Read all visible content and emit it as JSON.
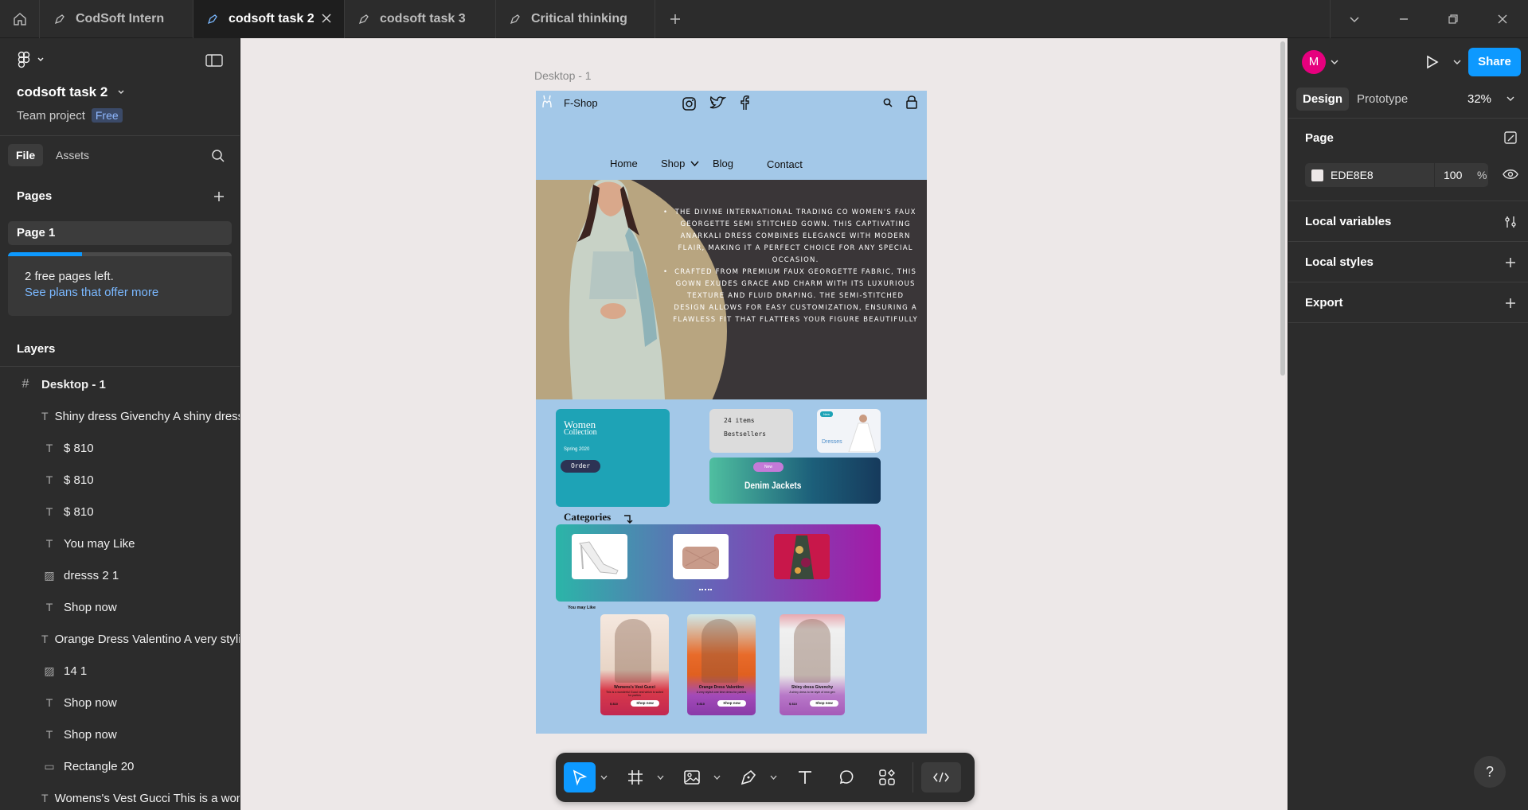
{
  "tabs": [
    {
      "label": "CodSoft Intern"
    },
    {
      "label": "codsoft task 2"
    },
    {
      "label": "codsoft task 3"
    },
    {
      "label": "Critical thinking"
    }
  ],
  "file": {
    "name": "codsoft task 2",
    "team": "Team project",
    "plan_badge": "Free"
  },
  "left_tabs": {
    "file": "File",
    "assets": "Assets"
  },
  "pages": {
    "title": "Pages",
    "items": [
      "Page 1"
    ],
    "notice": "2 free pages left.",
    "notice_link": "See plans that offer more",
    "notice_progress": 0.33
  },
  "layers": {
    "title": "Layers",
    "root": "Desktop - 1",
    "items": [
      {
        "label": "Shiny dress Givenchy A shiny dress",
        "icon": "text-icon"
      },
      {
        "label": "$ 810",
        "icon": "text-icon"
      },
      {
        "label": "$ 810",
        "icon": "text-icon"
      },
      {
        "label": "$ 810",
        "icon": "text-icon"
      },
      {
        "label": "You may Like",
        "icon": "text-icon"
      },
      {
        "label": "dresss 2 1",
        "icon": "image-icon"
      },
      {
        "label": "Shop now",
        "icon": "text-icon"
      },
      {
        "label": "Orange Dress Valentino A very stylish",
        "icon": "text-icon"
      },
      {
        "label": "14 1",
        "icon": "image-icon"
      },
      {
        "label": "Shop now",
        "icon": "text-icon"
      },
      {
        "label": "Shop now",
        "icon": "text-icon"
      },
      {
        "label": "Rectangle 20",
        "icon": "rectangle-icon"
      },
      {
        "label": "Womens's Vest Gucci This is a wonderful",
        "icon": "text-icon"
      }
    ]
  },
  "canvas": {
    "frame_label": "Desktop - 1"
  },
  "design": {
    "brand": "F-Shop",
    "nav": [
      "Home",
      "Shop",
      "Blog",
      "Contact"
    ],
    "hero_bullets": [
      "The Divine International Trading Co Women's Faux Georgette Semi Stitched Gown. This captivating Anarkali dress combines elegance with modern flair, making it a perfect choice for any special occasion.",
      "Crafted from premium faux georgette fabric, this gown exudes grace and charm with its luxurious texture and fluid draping. The semi-stitched design allows for easy customization, ensuring a flawless fit that flatters your figure beautifully"
    ],
    "women_collection": {
      "title": "Women",
      "subtitle": "Collection",
      "season": "Spring 2020",
      "button": "Order"
    },
    "bestsellers": {
      "count": "24 items",
      "label": "Bestsellers"
    },
    "dresses": {
      "badge": "New",
      "label": "Dresses"
    },
    "denim": {
      "badge": "New",
      "label": "Denim Jackets"
    },
    "categories": "Categories",
    "you_may_like": "You may Like",
    "products": [
      {
        "name": "Womens's Vest Gucci",
        "desc": "This is a wonderful Gucci vest which is suited for parties",
        "price": "$ 810",
        "button": "Shop now"
      },
      {
        "name": "Orange Dress Valentino",
        "desc": "A very stylish one time dress for parties",
        "price": "$ 810",
        "button": "Shop now"
      },
      {
        "name": "Shiny dress Givenchy",
        "desc": "A shiny dress to be style of new gen",
        "price": "$ 810",
        "button": "Shop now"
      }
    ]
  },
  "right_panel": {
    "avatar": "M",
    "share": "Share",
    "tabs": {
      "design": "Design",
      "prototype": "Prototype"
    },
    "zoom": "32%",
    "page_title": "Page",
    "page_color": "EDE8E8",
    "page_opacity": "100",
    "page_opacity_unit": "%",
    "sections": [
      "Local variables",
      "Local styles",
      "Export"
    ]
  },
  "colors": {
    "accent": "#0d99ff",
    "frame_bg": "#a3c8e8",
    "hero_dark": "#3a3638",
    "hero_tan": "#b8a580",
    "teal": "#1ea3b6"
  }
}
